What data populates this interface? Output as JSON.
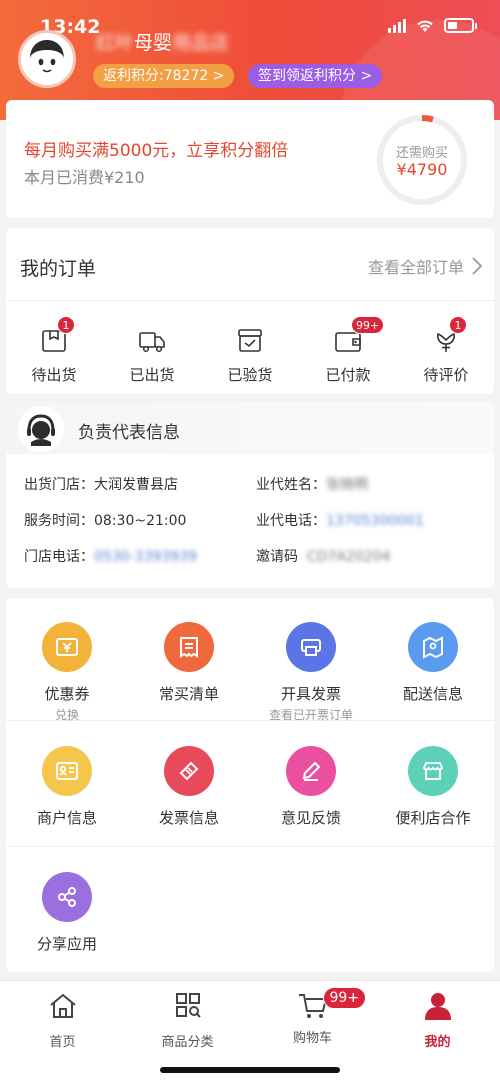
{
  "status": {
    "time": "13:42"
  },
  "header": {
    "store_name_prefix": "红叶",
    "store_name_mid": "母婴",
    "store_name_suffix": "用品店",
    "points_label": "返利积分:78272 >",
    "sign_label": "签到领返利积分 >"
  },
  "promo": {
    "title": "每月购买满5000元，立享积分翻倍",
    "subtitle": "本月已消费¥210",
    "ring_label": "还需购买",
    "ring_value": "¥4790",
    "progress": 0.042
  },
  "orders": {
    "title": "我的订单",
    "view_all": "查看全部订单",
    "items": [
      {
        "label": "待出货",
        "badge": "1",
        "icon": "box-icon"
      },
      {
        "label": "已出货",
        "badge": "",
        "icon": "truck-icon"
      },
      {
        "label": "已验货",
        "badge": "",
        "icon": "check-box-icon"
      },
      {
        "label": "已付款",
        "badge": "99+",
        "icon": "wallet-icon"
      },
      {
        "label": "待评价",
        "badge": "1",
        "icon": "flower-icon"
      }
    ]
  },
  "rep": {
    "title": "负责代表信息",
    "store_label": "出货门店：",
    "store_value": "大润发曹县店",
    "time_label": "服务时间：",
    "time_value": "08:30~21:00",
    "phone_label": "门店电话：",
    "phone_value": "0530-3393939",
    "agent_name_label": "业代姓名：",
    "agent_name_value": "张晓明",
    "agent_phone_label": "业代电话：",
    "agent_phone_value": "13705300001",
    "invite_label": "邀请码",
    "invite_value": "CD7A20204"
  },
  "services": [
    {
      "label": "优惠券",
      "sub": "兑换",
      "color": "#f3b23a",
      "icon": "coupon-icon"
    },
    {
      "label": "常买清单",
      "sub": "",
      "color": "#ee6a3c",
      "icon": "list-icon"
    },
    {
      "label": "开具发票",
      "sub": "查看已开票订单",
      "color": "#5b74e6",
      "icon": "printer-icon"
    },
    {
      "label": "配送信息",
      "sub": "",
      "color": "#5b9bef",
      "icon": "map-icon"
    },
    {
      "label": "商户信息",
      "sub": "",
      "color": "#f5c64b",
      "icon": "merchant-card-icon"
    },
    {
      "label": "发票信息",
      "sub": "",
      "color": "#e84a5c",
      "icon": "ticket-icon"
    },
    {
      "label": "意见反馈",
      "sub": "",
      "color": "#ea4fa0",
      "icon": "pencil-icon"
    },
    {
      "label": "便利店合作",
      "sub": "",
      "color": "#5cd1b8",
      "icon": "store-icon"
    },
    {
      "label": "分享应用",
      "sub": "",
      "color": "#9a6fe0",
      "icon": "share-icon"
    }
  ],
  "tabbar": {
    "items": [
      {
        "label": "首页",
        "icon": "home-icon"
      },
      {
        "label": "商品分类",
        "icon": "category-icon"
      },
      {
        "label": "购物车",
        "icon": "cart-icon",
        "badge": "99+"
      },
      {
        "label": "我的",
        "icon": "profile-icon",
        "active": true
      }
    ]
  }
}
